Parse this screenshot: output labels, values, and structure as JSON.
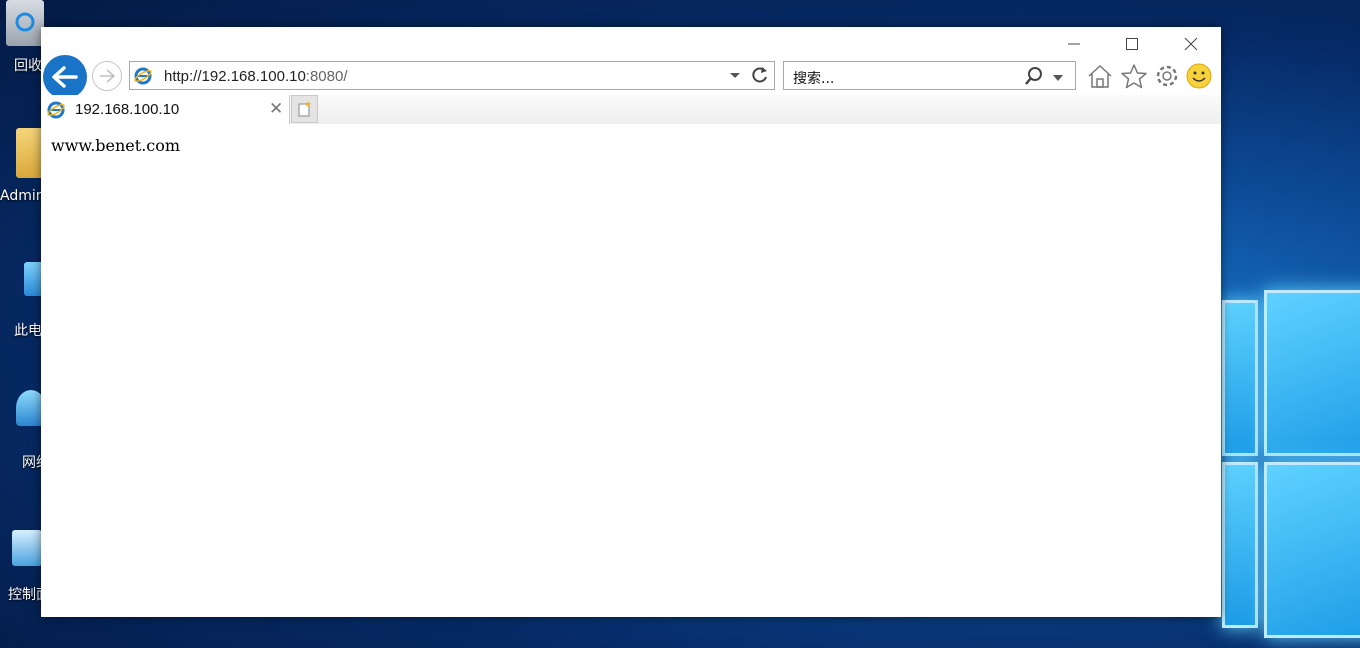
{
  "desktop": {
    "icons": [
      {
        "label": "回收",
        "icon": "recycle-bin-icon"
      },
      {
        "label": "Admin",
        "icon": "user-folder-icon"
      },
      {
        "label": "此电",
        "icon": "this-pc-icon"
      },
      {
        "label": "网络",
        "icon": "network-icon"
      },
      {
        "label": "控制面",
        "icon": "control-panel-icon"
      }
    ]
  },
  "browser": {
    "address": {
      "url_main": "http://192.168.100.10",
      "url_port": ":8080/"
    },
    "search": {
      "placeholder": "搜索..."
    },
    "tab": {
      "title": "192.168.100.10"
    },
    "content": {
      "text": "www.benet.com"
    },
    "accent": "#1973c6"
  }
}
